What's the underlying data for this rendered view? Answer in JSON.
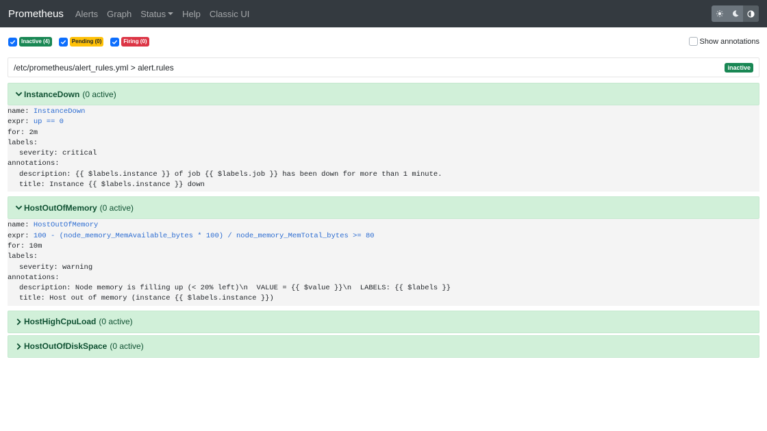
{
  "navbar": {
    "brand": "Prometheus",
    "links": [
      "Alerts",
      "Graph",
      "Status",
      "Help",
      "Classic UI"
    ]
  },
  "filters": [
    {
      "label": "Inactive (4)",
      "kind": "inactive",
      "checked": true
    },
    {
      "label": "Pending (0)",
      "kind": "pending",
      "checked": true
    },
    {
      "label": "Firing (0)",
      "kind": "firing",
      "checked": true
    }
  ],
  "show_annotations": {
    "label": "Show annotations",
    "checked": false
  },
  "file": {
    "path": "/etc/prometheus/alert_rules.yml > alert.rules",
    "state": "inactive"
  },
  "rules": [
    {
      "name": "InstanceDown",
      "count": "(0 active)",
      "expanded": true,
      "body": {
        "name_key": "name:",
        "name_val": "InstanceDown",
        "expr_key": "expr:",
        "expr_val": "up == 0",
        "for_line": "for: 2m",
        "labels_key": "labels:",
        "labels": [
          "severity: critical"
        ],
        "annotations_key": "annotations:",
        "annotations": [
          "description: {{ $labels.instance }} of job {{ $labels.job }} has been down for more than 1 minute.",
          "title: Instance {{ $labels.instance }} down"
        ]
      }
    },
    {
      "name": "HostOutOfMemory",
      "count": "(0 active)",
      "expanded": true,
      "body": {
        "name_key": "name:",
        "name_val": "HostOutOfMemory",
        "expr_key": "expr:",
        "expr_val": "100 - (node_memory_MemAvailable_bytes * 100) / node_memory_MemTotal_bytes >= 80",
        "for_line": "for: 10m",
        "labels_key": "labels:",
        "labels": [
          "severity: warning"
        ],
        "annotations_key": "annotations:",
        "annotations": [
          "description: Node memory is filling up (< 20% left)\\n  VALUE = {{ $value }}\\n  LABELS: {{ $labels }}",
          "title: Host out of memory (instance {{ $labels.instance }})"
        ]
      }
    },
    {
      "name": "HostHighCpuLoad",
      "count": "(0 active)",
      "expanded": false
    },
    {
      "name": "HostOutOfDiskSpace",
      "count": "(0 active)",
      "expanded": false
    }
  ],
  "colors": {
    "navbar_bg": "#343a40",
    "rule_header_bg": "#d1f0d9",
    "inactive": "#198754",
    "pending": "#ffc107",
    "firing": "#dc3545"
  }
}
